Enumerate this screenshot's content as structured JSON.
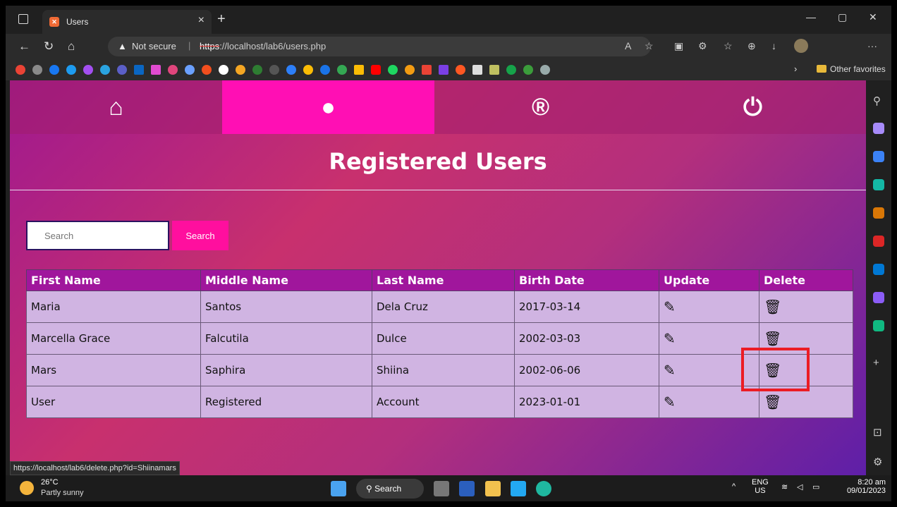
{
  "browser": {
    "tab_title": "Users",
    "tab_favicon": "xampp-icon",
    "not_secure": "Not secure",
    "url_scheme": "https",
    "url_rest": "://localhost/lab6/users.php",
    "other_favorites": "Other favorites",
    "status_link": "https://localhost/lab6/delete.php?id=Shiinamars"
  },
  "nav": {
    "home_icon": "home-icon",
    "user_icon": "user-icon",
    "register_icon": "registered-icon",
    "logout_icon": "power-icon",
    "active_color": "#ff0fb4"
  },
  "page": {
    "heading": "Registered Users",
    "search_placeholder": "Search",
    "search_button": "Search"
  },
  "table": {
    "headers": [
      "First Name",
      "Middle Name",
      "Last Name",
      "Birth Date",
      "Update",
      "Delete"
    ],
    "rows": [
      [
        "Maria",
        "Santos",
        "Dela Cruz",
        "2017-03-14"
      ],
      [
        "Marcella Grace",
        "Falcutila",
        "Dulce",
        "2002-03-03"
      ],
      [
        "Mars",
        "Saphira",
        "Shiina",
        "2002-06-06"
      ],
      [
        "User",
        "Registered",
        "Account",
        "2023-01-01"
      ]
    ]
  },
  "taskbar": {
    "temp": "26°C",
    "condition": "Partly sunny",
    "search_label": "Search",
    "lang": "ENG",
    "region": "US",
    "time": "8:20 am",
    "date": "09/01/2023"
  }
}
